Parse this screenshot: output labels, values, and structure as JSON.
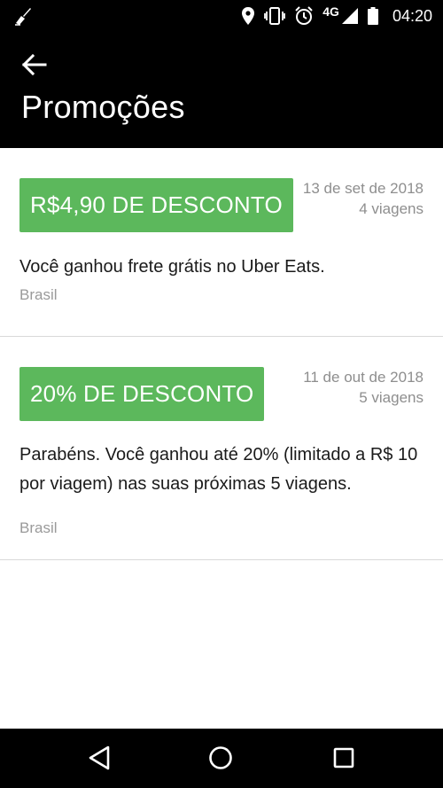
{
  "status_bar": {
    "network_label": "4G",
    "time": "04:20",
    "icons": [
      "cleaner-icon",
      "location-icon",
      "vibrate-icon",
      "alarm-icon",
      "signal-icon",
      "battery-icon"
    ]
  },
  "header": {
    "title": "Promoções",
    "back_icon": "back-arrow-icon"
  },
  "promotions": [
    {
      "badge": "R$4,90 DE DESCONTO",
      "date": "13 de set de 2018",
      "trips": "4 viagens",
      "description": "Você ganhou frete grátis no Uber Eats.",
      "region": "Brasil"
    },
    {
      "badge": "20% DE DESCONTO",
      "date": "11 de out de 2018",
      "trips": "5 viagens",
      "description": "Parabéns. Você ganhou até 20% (limitado a R$ 10 por viagem) nas suas próximas 5 viagens.",
      "region": "Brasil"
    }
  ],
  "colors": {
    "badge_green": "#5cb85c",
    "header_bg": "#000000",
    "meta_gray": "#8e8e8e"
  },
  "nav_bar": {
    "icons": [
      "nav-back-icon",
      "nav-home-icon",
      "nav-recents-icon"
    ]
  }
}
